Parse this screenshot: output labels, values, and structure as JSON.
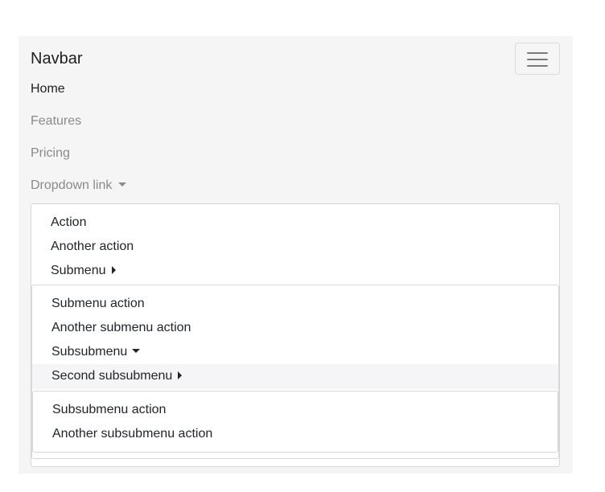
{
  "navbar": {
    "brand": "Navbar",
    "toggler_icon": "hamburger-icon",
    "links": [
      {
        "label": "Home",
        "active": true
      },
      {
        "label": "Features",
        "active": false
      },
      {
        "label": "Pricing",
        "active": false
      },
      {
        "label": "Dropdown link",
        "active": false
      }
    ]
  },
  "dropdown": {
    "items": [
      "Action",
      "Another action",
      "Submenu"
    ],
    "submenu": {
      "items": [
        "Submenu action",
        "Another submenu action",
        "Subsubmenu",
        "Second subsubmenu"
      ],
      "subsubmenu": {
        "items": [
          "Subsubmenu action",
          "Another subsubmenu action"
        ]
      }
    }
  },
  "colors": {
    "navbar_bg": "#f5f5f5",
    "text_active": "#1f1f1f",
    "text_muted": "#8a8a8a",
    "menu_border": "#d7d7d7",
    "hover_bg": "#f5f5f7"
  }
}
